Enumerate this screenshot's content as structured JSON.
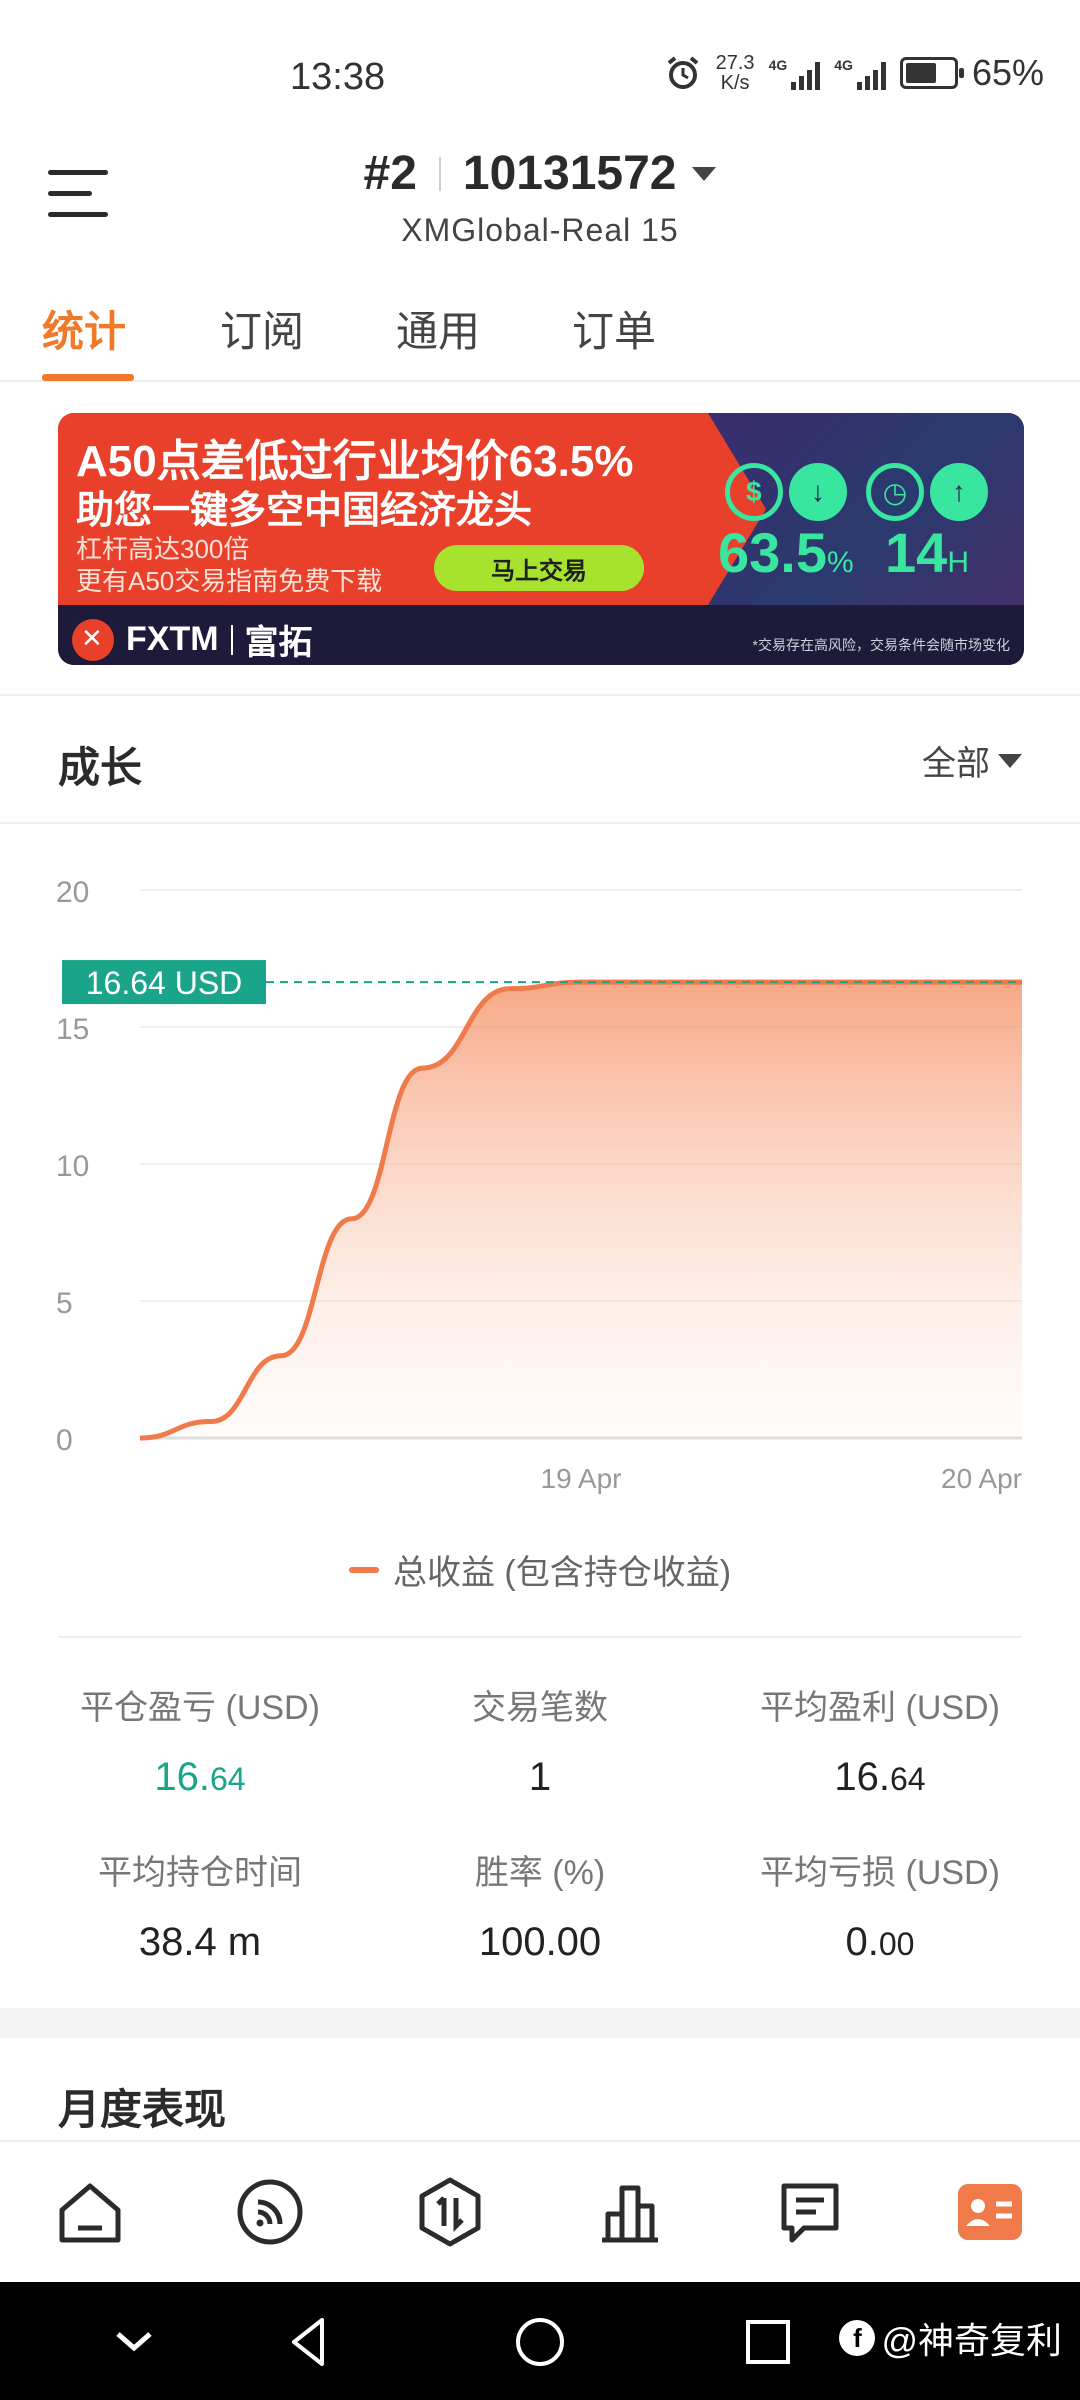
{
  "status_bar": {
    "time": "13:38",
    "net_speed_value": "27.3",
    "net_speed_unit": "K/s",
    "signal_1": "4G",
    "signal_2": "4G",
    "battery": "65%"
  },
  "header": {
    "account_index": "#2",
    "account_number": "10131572",
    "server": "XMGlobal-Real 15"
  },
  "tabs": [
    {
      "label": "统计",
      "active": true
    },
    {
      "label": "订阅",
      "active": false
    },
    {
      "label": "通用",
      "active": false
    },
    {
      "label": "订单",
      "active": false
    }
  ],
  "banner": {
    "headline": "A50点差低过行业均价63.5%",
    "subheadline": "助您一键多空中国经济龙头",
    "line1": "杠杆高达300倍",
    "line2": "更有A50交易指南免费下载",
    "cta": "马上交易",
    "brand": "FXTM",
    "brand_cn": "富拓",
    "metric1_value": "63.5",
    "metric1_unit": "%",
    "metric2_value": "14",
    "metric2_unit": "H",
    "disclaimer": "*交易存在高风险，交易条件会随市场变化"
  },
  "growth": {
    "title": "成长",
    "filter": "全部"
  },
  "chart_data": {
    "type": "area",
    "title": "",
    "x_labels": [
      "19 Apr",
      "20 Apr"
    ],
    "yticks": [
      "0",
      "5",
      "10",
      "15",
      "20"
    ],
    "ylim": [
      0,
      20
    ],
    "series": [
      {
        "name": "总收益 (包含持仓收益)",
        "color": "#f07a4a",
        "points": [
          [
            0,
            0
          ],
          [
            0.08,
            0.6
          ],
          [
            0.16,
            3.0
          ],
          [
            0.24,
            8.0
          ],
          [
            0.32,
            13.5
          ],
          [
            0.42,
            16.4
          ],
          [
            0.5,
            16.64
          ],
          [
            0.75,
            16.64
          ],
          [
            1.0,
            16.64
          ]
        ]
      }
    ],
    "current_value_label": "16.64 USD",
    "current_value": 16.64,
    "grid": true
  },
  "legend": {
    "label": "总收益 (包含持仓收益)"
  },
  "stats": [
    {
      "label": "平仓盈亏 (USD)",
      "value_main": "16.",
      "value_small": "64",
      "green": true
    },
    {
      "label": "交易笔数",
      "value_main": "1",
      "value_small": "",
      "green": false
    },
    {
      "label": "平均盈利 (USD)",
      "value_main": "16.",
      "value_small": "64",
      "green": false
    },
    {
      "label": "平均持仓时间",
      "value_main": "38.4 m",
      "value_small": "",
      "green": false
    },
    {
      "label": "胜率 (%)",
      "value_main": "100.00",
      "value_small": "",
      "green": false
    },
    {
      "label": "平均亏损 (USD)",
      "value_main": "0.",
      "value_small": "00",
      "green": false
    }
  ],
  "monthly": {
    "title": "月度表现"
  },
  "bottom_nav": [
    {
      "icon": "home-icon"
    },
    {
      "icon": "signal-feed-icon"
    },
    {
      "icon": "trade-icon"
    },
    {
      "icon": "chart-bar-icon"
    },
    {
      "icon": "message-icon"
    },
    {
      "icon": "profile-card-icon"
    }
  ],
  "watermark": "@神奇复利"
}
